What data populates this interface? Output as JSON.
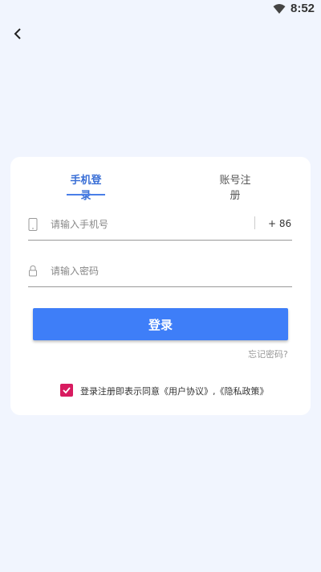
{
  "status_bar": {
    "time": "8:52",
    "icon": "wifi-icon"
  },
  "nav": {
    "back_icon": "chevron-left-icon"
  },
  "tabs": [
    {
      "label": "手机登录",
      "active": true
    },
    {
      "label": "账号注册",
      "active": false
    }
  ],
  "phone_field": {
    "icon": "phone-icon",
    "placeholder": "请输入手机号",
    "value": "",
    "country_code": "+ 86"
  },
  "password_field": {
    "icon": "lock-icon",
    "placeholder": "请输入密码",
    "value": ""
  },
  "login_button": {
    "label": "登录"
  },
  "forgot_password": {
    "label": "忘记密码?"
  },
  "agreement": {
    "checked": true,
    "prefix": "登录注册即表示同意",
    "user_agreement": "《用户协议》",
    "separator": ",",
    "privacy_policy": "《隐私政策》"
  },
  "colors": {
    "accent": "#3e7ef8",
    "tab_active": "#3a6fd6",
    "checkbox": "#d81b60",
    "background": "#f1f5fe"
  }
}
